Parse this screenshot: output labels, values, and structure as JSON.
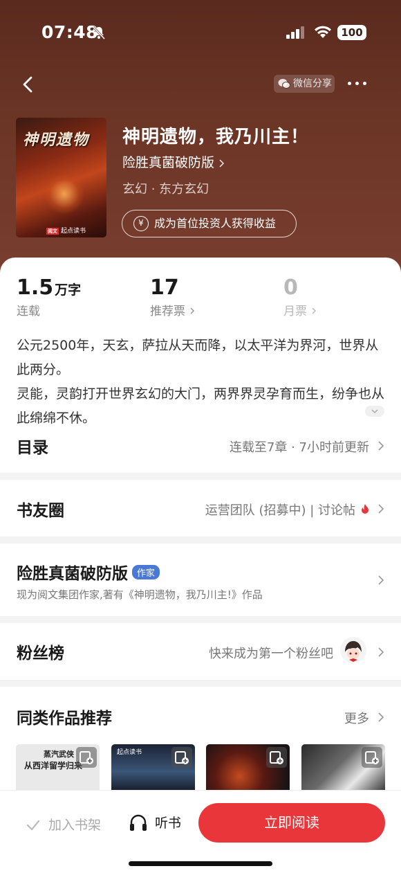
{
  "status": {
    "time": "07:48",
    "battery": "100"
  },
  "nav": {
    "share_label": "微信分享"
  },
  "book": {
    "cover_title": "神明遗物",
    "cover_publisher": "起点读书",
    "cover_publisher_tag": "阅文",
    "title": "神明遗物，我乃川主！",
    "author": "险胜真菌破防版",
    "genre": "玄幻 · 东方玄幻",
    "invest_label": "成为首位投资人获得收益"
  },
  "stats": [
    {
      "value": "1.5",
      "unit": "万字",
      "label": "连载"
    },
    {
      "value": "17",
      "label": "推荐票"
    },
    {
      "value": "0",
      "label": "月票"
    }
  ],
  "description": [
    "公元2500年，天玄，萨拉从天而降，以太平洋为界河，世界从此两分。",
    "灵能，灵韵打开世界玄幻的大门，两界界灵孕育而生，纷争也从此绵绵不休。"
  ],
  "catalog": {
    "label": "目录",
    "info": "连载至7章 · 7小时前更新"
  },
  "circle": {
    "label": "书友圈",
    "info": "运营团队 (招募中) | 讨论帖"
  },
  "author_section": {
    "name": "险胜真菌破防版",
    "badge": "作家",
    "bio": "现为阅文集团作家,著有《神明遗物，我乃川主!》作品"
  },
  "fans": {
    "label": "粉丝榜",
    "info": "快来成为第一个粉丝吧"
  },
  "similar": {
    "label": "同类作品推荐",
    "more": "更多",
    "items": [
      {
        "line1": "蒸汽武侠",
        "line2": "从西洋留学归来",
        "bg": "#e9e9e9"
      },
      {
        "line1": "起点读书",
        "line2": "",
        "bg": "#2a3650"
      },
      {
        "line1": "",
        "line2": "",
        "bg": "#1e1a1c"
      },
      {
        "line1": "",
        "line2": "",
        "bg": "#3a3a3a"
      }
    ]
  },
  "bottom": {
    "shelf": "加入书架",
    "listen": "听书",
    "read": "立即阅读"
  },
  "colors": {
    "accent": "#e8363b",
    "hero": "#6b3526",
    "badge": "#4a78d6"
  }
}
